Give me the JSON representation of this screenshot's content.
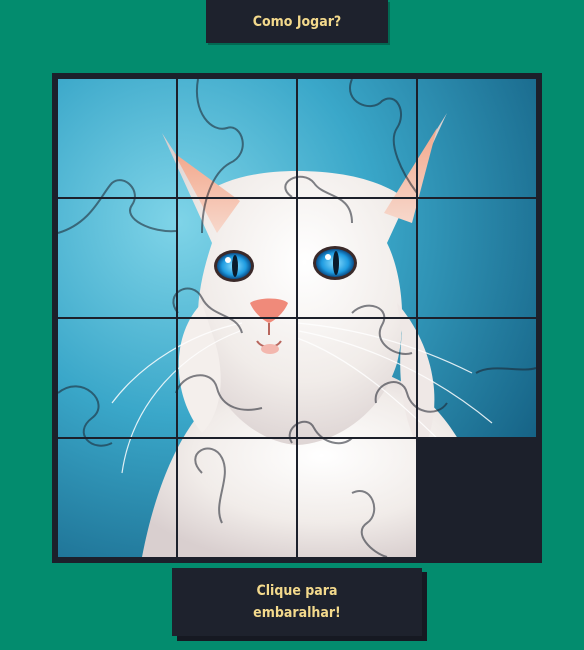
{
  "header": {
    "how_to_play_label": "Como Jogar?"
  },
  "puzzle": {
    "rows": 4,
    "cols": 4,
    "empty_tile": {
      "row": 4,
      "col": 4
    },
    "image_subject": "white-cat-with-blue-eyes",
    "colors": {
      "background": "#038c6e",
      "board_frame": "#1c202b",
      "button_bg": "#1e222d",
      "button_text": "#f3d98c",
      "image_bg": "#2f9fc2"
    }
  },
  "footer": {
    "shuffle_label": "Clique para embaralhar!"
  }
}
